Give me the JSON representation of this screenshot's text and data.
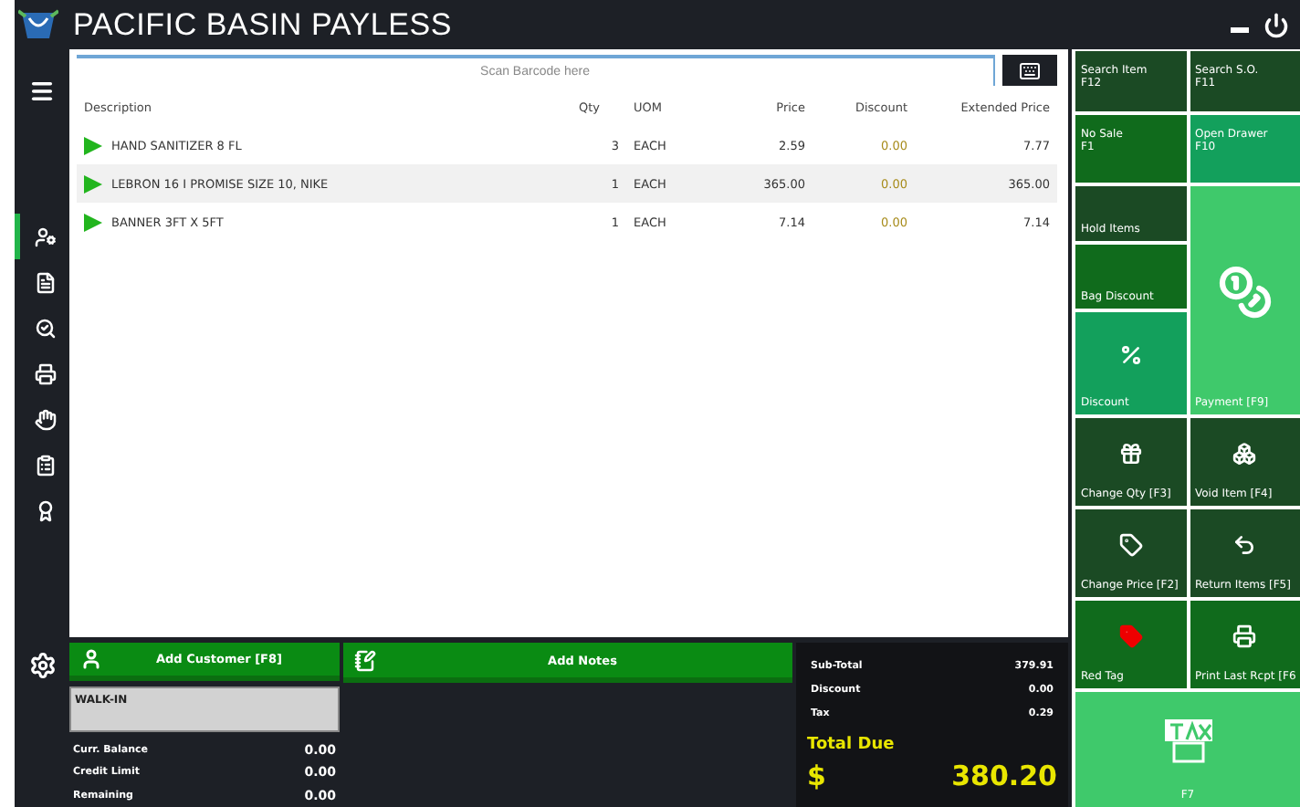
{
  "window": {
    "title": "PACIFIC BASIN PAYLESS"
  },
  "nav": [
    {
      "selected": true
    },
    {
      "selected": false
    },
    {
      "selected": false
    },
    {
      "selected": false
    },
    {
      "selected": false
    },
    {
      "selected": false
    },
    {
      "selected": false
    }
  ],
  "scan": {
    "placeholder": "Scan Barcode here"
  },
  "table": {
    "columns": [
      "Description",
      "Qty",
      "UOM",
      "Price",
      "Discount",
      "Extended Price"
    ],
    "rows": [
      {
        "description": "HAND SANITIZER 8 FL",
        "qty": "3",
        "uom": "EACH",
        "price": "2.59",
        "discount": "0.00",
        "extended": "7.77",
        "selected": false
      },
      {
        "description": "LEBRON 16 I PROMISE SIZE 10, NIKE",
        "qty": "1",
        "uom": "EACH",
        "price": "365.00",
        "discount": "0.00",
        "extended": "365.00",
        "selected": true
      },
      {
        "description": "BANNER 3FT X 5FT",
        "qty": "1",
        "uom": "EACH",
        "price": "7.14",
        "discount": "0.00",
        "extended": "7.14",
        "selected": false
      }
    ]
  },
  "customer": {
    "button": "Add Customer [F8]",
    "name": "WALK-IN",
    "rows": [
      {
        "label": "Curr. Balance",
        "value": "0.00"
      },
      {
        "label": "Credit Limit",
        "value": "0.00"
      },
      {
        "label": "Remaining",
        "value": "0.00"
      }
    ]
  },
  "notes": {
    "button": "Add Notes"
  },
  "totals": {
    "rows": [
      {
        "label": "Sub-Total",
        "value": "379.91"
      },
      {
        "label": "Discount",
        "value": "0.00"
      },
      {
        "label": "Tax",
        "value": "0.29"
      }
    ],
    "due_label": "Total Due",
    "currency": "$",
    "due": "380.20"
  },
  "tiles": [
    {
      "label": "Search Item",
      "key": "F12",
      "color": "#1b4a24"
    },
    {
      "label": "Search S.O.",
      "key": "F11",
      "color": "#1b4a24"
    },
    {
      "label": "No Sale",
      "key": "F1",
      "color": "#106b1c"
    },
    {
      "label": "Open Drawer",
      "key": "F10",
      "color": "#13a05c"
    },
    {
      "label": "Hold Items",
      "color": "#1b4a24"
    },
    {
      "label": "Payment [F9]",
      "color": "#3fc96b"
    },
    {
      "label": "Bag Discount",
      "color": "#106b1c"
    },
    {
      "label": "Discount",
      "color": "#13a05c"
    },
    {
      "label": "Change Qty [F3]",
      "color": "#1b4a24"
    },
    {
      "label": "Void Item [F4]",
      "color": "#1b4a24"
    },
    {
      "label": "Change Price [F2]",
      "color": "#1b4a24"
    },
    {
      "label": "Return Items [F5]",
      "color": "#1b4a24"
    },
    {
      "label": "Red Tag",
      "color": "#106b1c"
    },
    {
      "label": "Print Last Rcpt [F6",
      "color": "#106b1c"
    },
    {
      "label": "F7",
      "color": "#3fc96b"
    }
  ]
}
